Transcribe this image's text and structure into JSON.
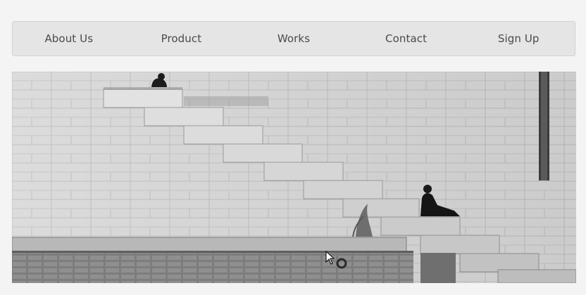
{
  "nav": {
    "items": [
      {
        "label": "About Us"
      },
      {
        "label": "Product"
      },
      {
        "label": "Works"
      },
      {
        "label": "Contact"
      },
      {
        "label": "Sign Up"
      }
    ]
  },
  "hero": {
    "subject": "stone-steps-photo"
  },
  "colors": {
    "page_bg": "#f4f4f4",
    "nav_bg": "#e5e5e5",
    "nav_text": "#4a4a4a"
  }
}
